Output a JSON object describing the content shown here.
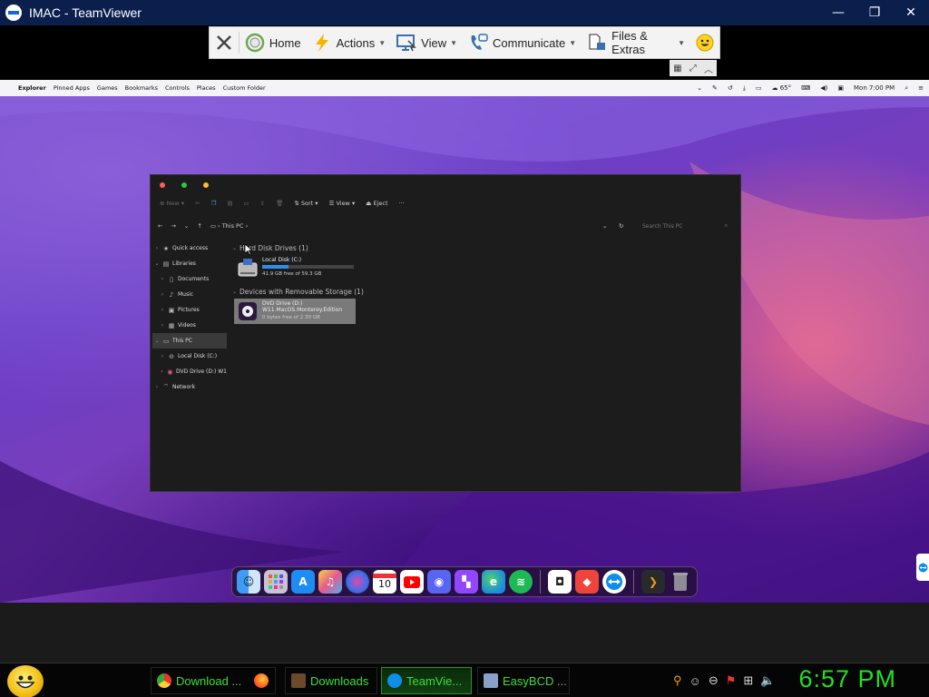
{
  "window": {
    "title": "IMAC - TeamViewer",
    "minimize_glyph": "—",
    "restore_glyph": "❐",
    "close_glyph": "✕"
  },
  "tv_toolbar": {
    "items": [
      {
        "label": "Home",
        "icon": "home-icon"
      },
      {
        "label": "Actions",
        "icon": "actions-lightning-icon"
      },
      {
        "label": "View",
        "icon": "view-monitor-icon"
      },
      {
        "label": "Communicate",
        "icon": "communicate-phone-icon"
      },
      {
        "label": "Files & Extras",
        "icon": "files-extras-icon"
      }
    ]
  },
  "mac_menubar": {
    "app": "Explorer",
    "menus": [
      "Pinned Apps",
      "Games",
      "Bookmarks",
      "Controls",
      "Places",
      "Custom Folder"
    ],
    "temperature": "65°",
    "clock": "Mon 7:00 PM"
  },
  "explorer": {
    "toolbar": {
      "new": "New",
      "sort": "Sort",
      "view": "View",
      "eject": "Eject",
      "more": "···"
    },
    "path": [
      "This PC"
    ],
    "search_placeholder": "Search This PC",
    "sidebar": [
      {
        "label": "Quick access",
        "icon": "star-icon",
        "indent": 0,
        "expanded": false
      },
      {
        "label": "Libraries",
        "icon": "libraries-icon",
        "indent": 0,
        "expanded": true
      },
      {
        "label": "Documents",
        "icon": "documents-icon",
        "indent": 1,
        "expanded": false
      },
      {
        "label": "Music",
        "icon": "music-icon",
        "indent": 1,
        "expanded": false
      },
      {
        "label": "Pictures",
        "icon": "pictures-icon",
        "indent": 1,
        "expanded": false
      },
      {
        "label": "Videos",
        "icon": "videos-icon",
        "indent": 1,
        "expanded": false
      },
      {
        "label": "This PC",
        "icon": "pc-icon",
        "indent": 0,
        "expanded": true,
        "selected": true
      },
      {
        "label": "Local Disk (C:)",
        "icon": "disk-icon",
        "indent": 1,
        "expanded": false
      },
      {
        "label": "DVD Drive (D:) W1",
        "icon": "dvd-icon",
        "indent": 1,
        "expanded": false
      },
      {
        "label": "Network",
        "icon": "network-icon",
        "indent": 0,
        "expanded": false
      }
    ],
    "groups": [
      {
        "header": "Hard Disk Drives (1)",
        "drives": [
          {
            "name": "Local Disk (C:)",
            "free": "41.9 GB free of 59.3 GB",
            "used_fraction": 0.29,
            "icon": "hard-disk-icon",
            "selected": false
          }
        ]
      },
      {
        "header": "Devices with Removable Storage (1)",
        "drives": [
          {
            "name": "DVD Drive (D:)",
            "label": "W11.MacOS.Monterey.Edition",
            "free": "0 bytes free of 2.30 GB",
            "icon": "dvd-drive-icon",
            "selected": true
          }
        ]
      }
    ]
  },
  "dock": {
    "apps": [
      "finder",
      "launchpad",
      "app-store",
      "itunes",
      "siri",
      "calendar",
      "youtube",
      "discord",
      "twitch",
      "edge",
      "spotify"
    ],
    "calendar_day": "10",
    "pinned": [
      "roblox",
      "anydesk",
      "teamviewer"
    ],
    "others": [
      "plex",
      "trash"
    ]
  },
  "taskbar": {
    "tasks": [
      {
        "label": "Download ...",
        "icon": "chrome-icon",
        "active": false
      },
      {
        "label": "",
        "icon": "firefox-icon",
        "active": false
      },
      {
        "label": "Downloads",
        "icon": "folder-icon",
        "active": false
      },
      {
        "label": "TeamVie...",
        "icon": "teamviewer-icon",
        "active": true
      },
      {
        "label": "EasyBCD ...",
        "icon": "easybcd-icon",
        "active": false
      }
    ],
    "clock": "6:57 PM"
  },
  "colors": {
    "teamviewer_blue": "#0b1f4d",
    "taskbar_text": "#3ddf3d",
    "clock": "#22e022",
    "progress_blue": "#2e8fe6"
  }
}
